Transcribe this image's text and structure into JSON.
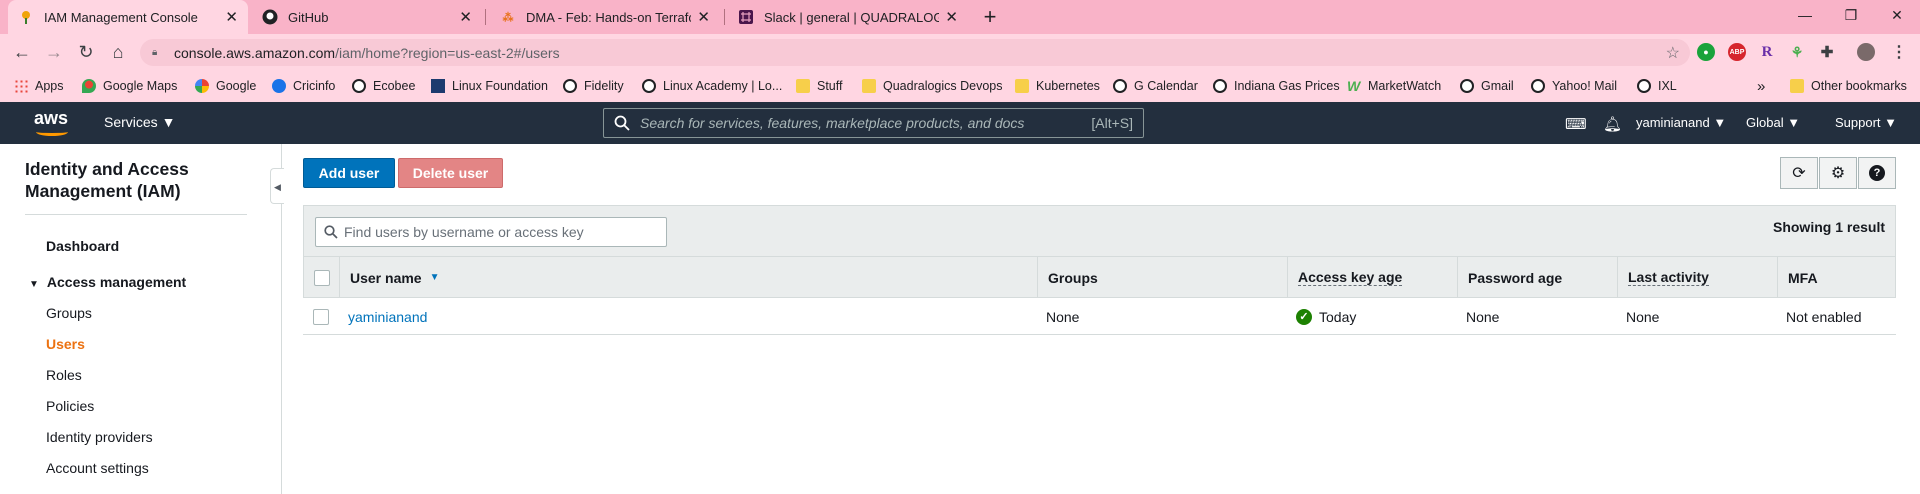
{
  "browser": {
    "tabs": [
      {
        "title": "IAM Management Console",
        "icon": "aws-icon"
      },
      {
        "title": "GitHub",
        "icon": "github-icon"
      },
      {
        "title": "DMA - Feb: Hands-on Terraform",
        "icon": "dma-icon"
      },
      {
        "title": "Slack | general | QUADRALOGICS",
        "icon": "slack-icon"
      }
    ],
    "url_host": "console.aws.amazon.com",
    "url_path": "/iam/home?region=us-east-2#/users",
    "bookmarks": [
      "Apps",
      "Google Maps",
      "Google",
      "Cricinfo",
      "Ecobee",
      "Linux Foundation",
      "Fidelity",
      "Linux Academy | Lo...",
      "Stuff",
      "Quadralogics Devops",
      "Kubernetes",
      "G Calendar",
      "Indiana Gas Prices",
      "MarketWatch",
      "Gmail",
      "Yahoo! Mail",
      "IXL"
    ],
    "bookmarks_overflow": "»",
    "other_bookmarks": "Other bookmarks",
    "extension_abp": "ABP",
    "extension_r": "R"
  },
  "aws_nav": {
    "logo_text": "aws",
    "services_label": "Services",
    "search_placeholder": "Search for services, features, marketplace products, and docs",
    "search_shortcut": "[Alt+S]",
    "account": "yaminianand",
    "region": "Global",
    "support": "Support"
  },
  "sidebar": {
    "title": "Identity and Access Management (IAM)",
    "dashboard": "Dashboard",
    "access_management": "Access management",
    "items": [
      "Groups",
      "Users",
      "Roles",
      "Policies",
      "Identity providers",
      "Account settings"
    ],
    "active_item": "Users"
  },
  "actions": {
    "add_user": "Add user",
    "delete_user": "Delete user"
  },
  "filter": {
    "placeholder": "Find users by username or access key",
    "showing": "Showing 1 result"
  },
  "table": {
    "columns": [
      "User name",
      "Groups",
      "Access key age",
      "Password age",
      "Last activity",
      "MFA"
    ],
    "rows": [
      {
        "user_name": "yaminianand",
        "groups": "None",
        "access_key_age": "Today",
        "password_age": "None",
        "last_activity": "None",
        "mfa": "Not enabled"
      }
    ]
  },
  "colors": {
    "tab_strip": "#f9b3c8",
    "aws_nav": "#232f3e",
    "primary": "#0073bb",
    "active_nav": "#ec7211",
    "status_ok": "#1d8102"
  }
}
